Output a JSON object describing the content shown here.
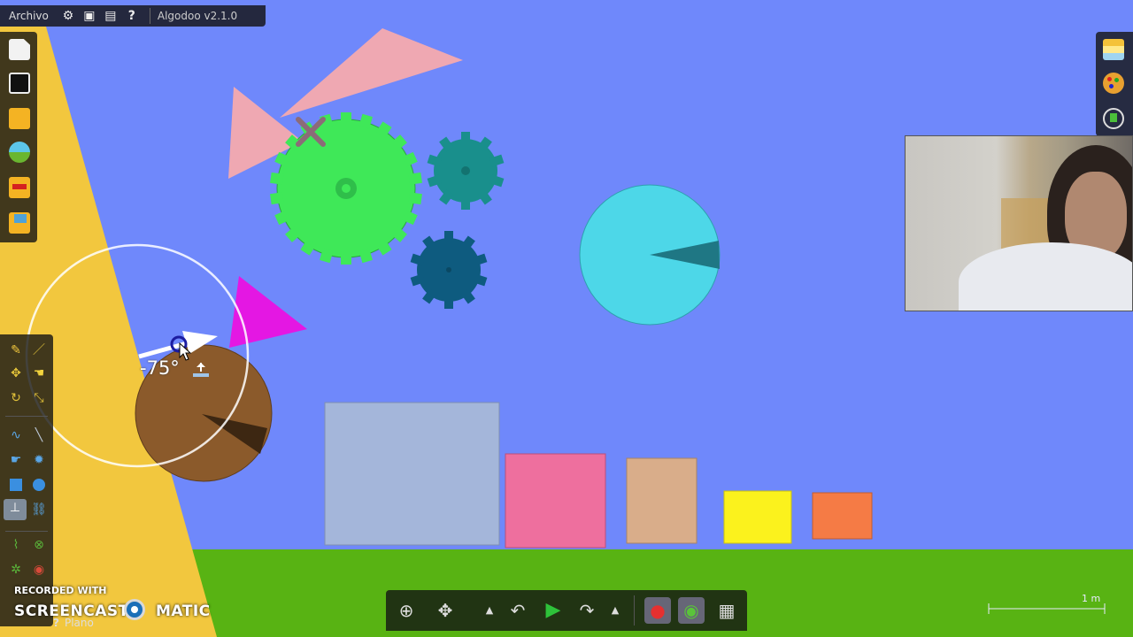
{
  "menu": {
    "archivo_label": "Archivo",
    "version_label": "Algodoo v2.1.0"
  },
  "topbar_icons": [
    "settings-gear-icon",
    "play-scene-icon",
    "window-icon",
    "help-icon"
  ],
  "file_toolbar_icons": [
    "new-scene-icon",
    "save-icon",
    "open-folder-icon",
    "browse-online-icon",
    "phunlets-icon",
    "scene-folder-icon"
  ],
  "tools": [
    "sketch-tool",
    "cut-tool",
    "move-tool",
    "drag-tool",
    "rotate-tool",
    "scale-tool",
    "rope-tool",
    "knife-tool",
    "brush-tool",
    "gear-tool",
    "box-tool",
    "circle-tool",
    "plane-tool",
    "chain-tool",
    "spring-tool",
    "fixate-tool",
    "axle-tool",
    "thruster-tool",
    "laser-tool"
  ],
  "rotation_readout": "-75°",
  "bottom_toolbar": [
    "zoom-icon",
    "pan-icon",
    "undo-menu-arrow",
    "undo-icon",
    "play-icon",
    "redo-icon",
    "redo-menu-arrow",
    "gravity-icon",
    "air-friction-icon",
    "grid-icon"
  ],
  "right_toolbar": [
    "layers-icon",
    "appearance-palette-icon",
    "properties-icon"
  ],
  "scale_label": "1 m",
  "watermark": {
    "line1": "RECORDED WITH",
    "brand_left": "SCREENCAST",
    "brand_right": "MATIC"
  },
  "hint_label": "Plano",
  "colors": {
    "sky": "#6f88fb",
    "ground": "#58b313",
    "yellow_ramp": "#f2c73e",
    "green_gear": "#3fe858",
    "teal_gear": "#198f8c",
    "navy_gear": "#0e5b7f",
    "cyan_circle": "#4dd7e8",
    "brown_circle": "#8b5a2b",
    "magenta_triangle": "#e417e3",
    "pink_triangle": "#efa8b2",
    "box_gray": "#a4b6da",
    "box_pink": "#ee6f9e",
    "box_tan": "#d9ad8a",
    "box_yellow": "#fbf21d",
    "box_orange": "#f57b45"
  }
}
